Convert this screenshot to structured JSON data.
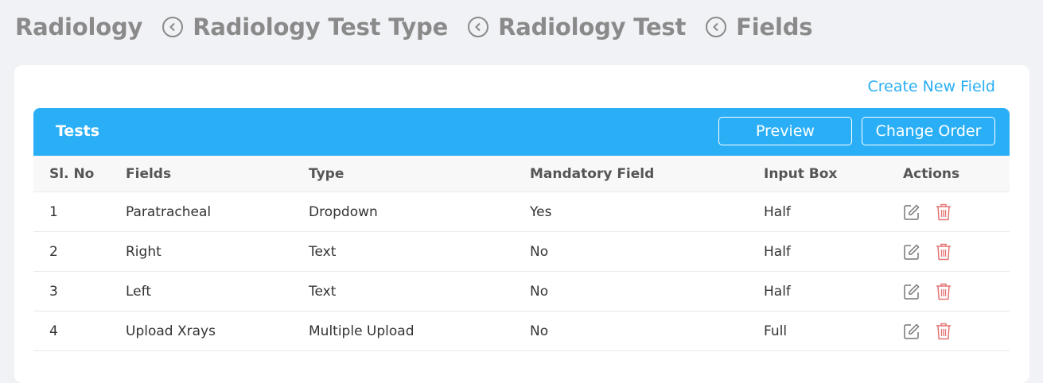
{
  "breadcrumb": {
    "items": [
      "Radiology",
      "Radiology Test Type",
      "Radiology Test",
      "Fields"
    ]
  },
  "card": {
    "create_link": "Create New Field",
    "panel_title": "Tests",
    "preview_label": "Preview",
    "change_order_label": "Change Order"
  },
  "table": {
    "columns": [
      "Sl. No",
      "Fields",
      "Type",
      "Mandatory Field",
      "Input Box",
      "Actions"
    ],
    "rows": [
      {
        "sl": "1",
        "field": "Paratracheal",
        "type": "Dropdown",
        "mandatory": "Yes",
        "input_box": "Half"
      },
      {
        "sl": "2",
        "field": "Right",
        "type": "Text",
        "mandatory": "No",
        "input_box": "Half"
      },
      {
        "sl": "3",
        "field": "Left",
        "type": "Text",
        "mandatory": "No",
        "input_box": "Half"
      },
      {
        "sl": "4",
        "field": "Upload Xrays",
        "type": "Multiple Upload",
        "mandatory": "No",
        "input_box": "Full"
      }
    ]
  },
  "icons": {
    "back": "chevron-left-circle-icon",
    "edit": "edit-icon",
    "delete": "trash-icon"
  },
  "colors": {
    "accent": "#2aaff7",
    "link": "#29aef3",
    "delete": "#e57373",
    "breadcrumb": "#8a8a8a",
    "background": "#f1f2f6"
  }
}
